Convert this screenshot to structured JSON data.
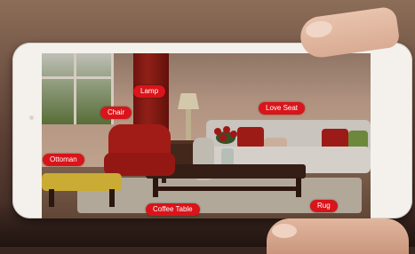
{
  "tags": {
    "lamp": "Lamp",
    "chair": "Chair",
    "love_seat": "Love Seat",
    "ottoman": "Ottoman",
    "coffee_table": "Coffee Table",
    "rug": "Rug"
  },
  "colors": {
    "tag_background": "#d9141a",
    "tag_text": "#ffffff",
    "phone_body": "#f4f1ec",
    "armchair": "#b51f1a",
    "ottoman": "#e4c23a"
  }
}
